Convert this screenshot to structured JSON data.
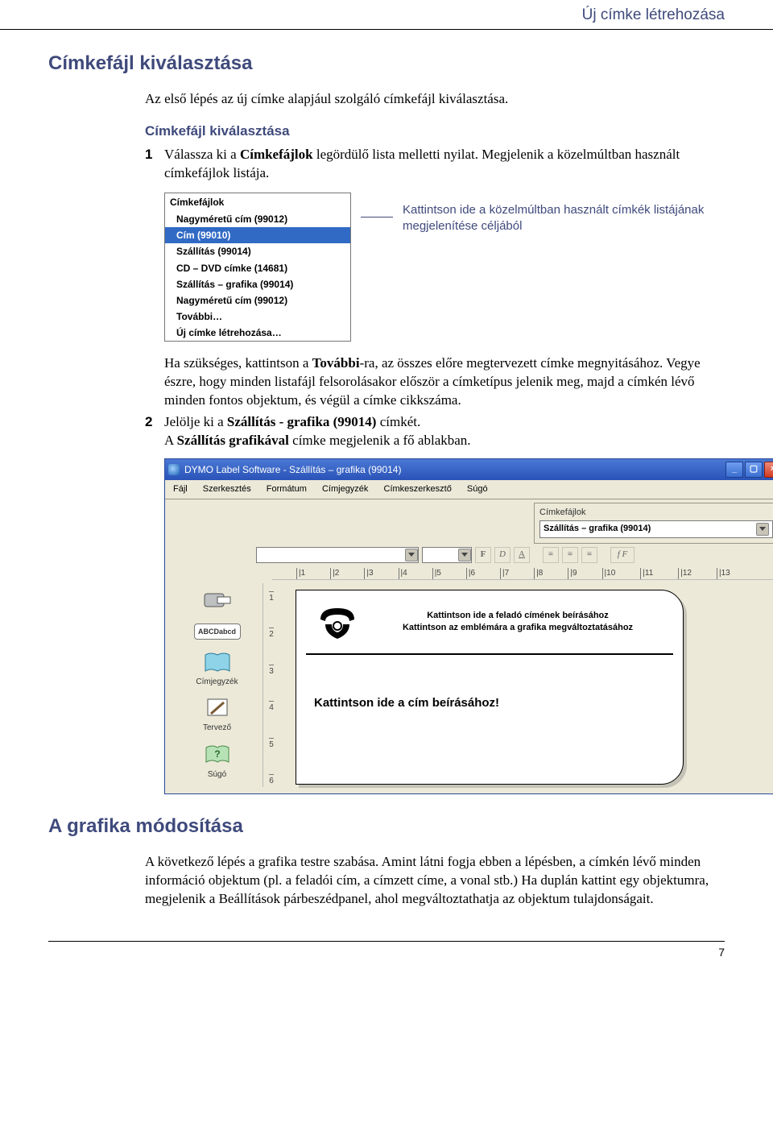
{
  "header": {
    "running": "Új címke létrehozása"
  },
  "section1": {
    "title": "Címkefájl kiválasztása",
    "intro": "Az első lépés az új címke alapjául szolgáló címkefájl kiválasztása.",
    "subhead": "Címkefájl kiválasztása",
    "step1": {
      "num": "1",
      "text_before": "Válassza ki a ",
      "bold": "Címkefájlok",
      "text_after": " legördülő lista melletti nyilat. Megjelenik a közelmúltban használt címkefájlok listája."
    },
    "dropdown": {
      "title": "Címkefájlok",
      "items": [
        "Nagyméretű cím (99012)",
        "Cím (99010)",
        "Szállítás (99014)",
        "CD – DVD címke (14681)",
        "Szállítás – grafika (99014)",
        "Nagyméretű cím (99012)",
        "További…",
        "Új címke létrehozása…"
      ],
      "selected_index": 1
    },
    "callout": "Kattintson ide a közelmúltban használt címkék listájának megjelenítése céljából",
    "para_a": {
      "t1": "Ha szükséges, kattintson a ",
      "b1": "További",
      "t2": "-ra, az összes előre megtervezett címke megnyitásához. Vegye észre, hogy minden listafájl felsorolásakor először a címketípus jelenik meg, majd a címkén lévő minden fontos objektum, és végül a címke cikkszáma."
    },
    "step2": {
      "num": "2",
      "t1": "Jelölje ki a ",
      "b1": "Szállítás - grafika (99014)",
      "t2": " címkét.",
      "t3_a": "A ",
      "t3_b": "Szállítás grafikával",
      "t3_c": " címke megjelenik a fő ablakban."
    }
  },
  "app": {
    "title": "DYMO Label Software - Szállítás – grafika (99014)",
    "menus": [
      "Fájl",
      "Szerkesztés",
      "Formátum",
      "Címjegyzék",
      "Címkeszerkesztő",
      "Súgó"
    ],
    "cf_label": "Címkefájlok",
    "cf_value": "Szállítás – grafika (99014)",
    "fmt": {
      "bold": "F",
      "italic": "D",
      "under": "A",
      "alignL": "≡",
      "alignC": "≡",
      "alignR": "≡",
      "font": "f F"
    },
    "ruler": [
      "|1",
      "|2",
      "|3",
      "|4",
      "|5",
      "|6",
      "|7",
      "|8",
      "|9",
      "|10",
      "|11",
      "|12",
      "|13"
    ],
    "vruler": [
      "1",
      "2",
      "3",
      "4",
      "5",
      "6"
    ],
    "sidebar": [
      {
        "label": "",
        "icon": "dispenser-icon"
      },
      {
        "label": "",
        "icon": "abc-icon"
      },
      {
        "label": "Címjegyzék",
        "icon": "book-icon"
      },
      {
        "label": "Tervező",
        "icon": "palette-icon"
      },
      {
        "label": "Súgó",
        "icon": "help-icon"
      }
    ],
    "label_hint1": "Kattintson ide a feladó címének beírásához",
    "label_hint2": "Kattintson az emblémára a grafika megváltoztatásához",
    "label_edit": "Kattintson ide a cím beírásához!"
  },
  "section2": {
    "title": "A grafika módosítása",
    "para": "A következő lépés a grafika testre szabása. Amint látni fogja ebben a lépésben, a címkén lévő minden információ objektum (pl. a feladói cím, a címzett címe, a vonal stb.) Ha duplán kattint egy objektumra, megjelenik a Beállítások párbeszédpanel, ahol megváltoztathatja az objektum tulajdonságait."
  },
  "page_number": "7"
}
